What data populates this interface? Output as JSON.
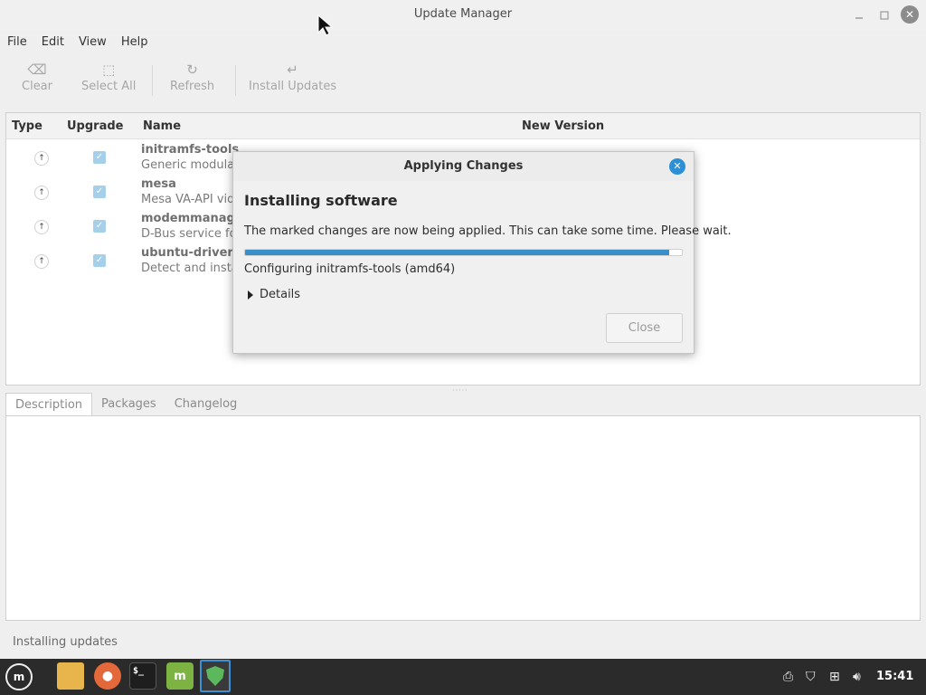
{
  "window": {
    "title": "Update Manager"
  },
  "menu": [
    "File",
    "Edit",
    "View",
    "Help"
  ],
  "toolbar": {
    "clear": "Clear",
    "select_all": "Select All",
    "refresh": "Refresh",
    "install_updates": "Install Updates"
  },
  "list": {
    "headers": {
      "type": "Type",
      "upgrade": "Upgrade",
      "name": "Name",
      "new_version": "New Version"
    },
    "rows": [
      {
        "name": "initramfs-tools",
        "desc": "Generic modular",
        "checked": true
      },
      {
        "name": "mesa",
        "desc": "Mesa VA-API vide",
        "checked": true
      },
      {
        "name": "modemmanager",
        "desc": "D-Bus service for",
        "checked": true
      },
      {
        "name": "ubuntu-drivers-",
        "desc": "Detect and instal",
        "checked": true
      }
    ]
  },
  "tabs": [
    "Description",
    "Packages",
    "Changelog"
  ],
  "status": "Installing updates",
  "dialog": {
    "title": "Applying Changes",
    "heading": "Installing software",
    "message": "The marked changes are now being applied. This can take some time. Please wait.",
    "progress": 0.97,
    "status": "Configuring initramfs-tools (amd64)",
    "details": "Details",
    "close": "Close"
  },
  "taskbar": {
    "clock": "15:41"
  },
  "icons": {
    "clear": "backspace-icon",
    "select_all": "select-all-icon",
    "refresh": "refresh-icon",
    "install": "install-arrow-icon"
  },
  "colors": {
    "accent": "#3a8fc9",
    "close_blue": "#2d8fd5",
    "taskbar": "#2b2b2b"
  }
}
